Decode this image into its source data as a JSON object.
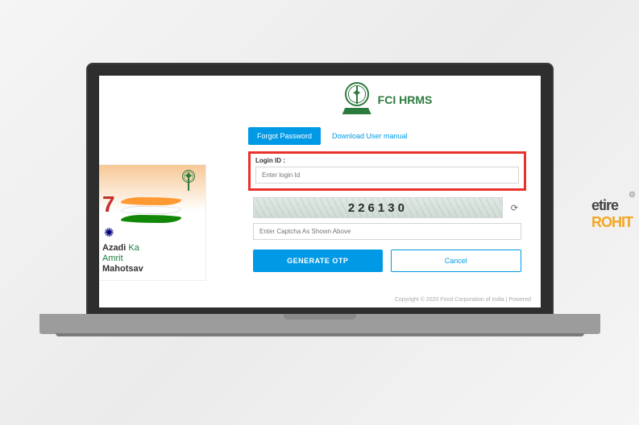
{
  "app": {
    "title": "FCI HRMS"
  },
  "tabs": {
    "forgot": "Forgot Password",
    "manual": "Download User manual"
  },
  "form": {
    "login_label": "Login ID :",
    "login_placeholder": "Enter login Id",
    "captcha_value": "226130",
    "captcha_placeholder": "Enter Captcha As Shown Above",
    "generate_btn": "GENERATE OTP",
    "cancel_btn": "Cancel"
  },
  "banner": {
    "number": "7",
    "line1a": "Azadi",
    "line1b": "Ka",
    "line2a": "Amrit",
    "line2b": "Mahotsav"
  },
  "footer": "Copyright © 2020 Food Corporation of India | Powered",
  "watermark": {
    "left": "etir",
    "e": "e",
    "bottom": "ROHIT"
  }
}
